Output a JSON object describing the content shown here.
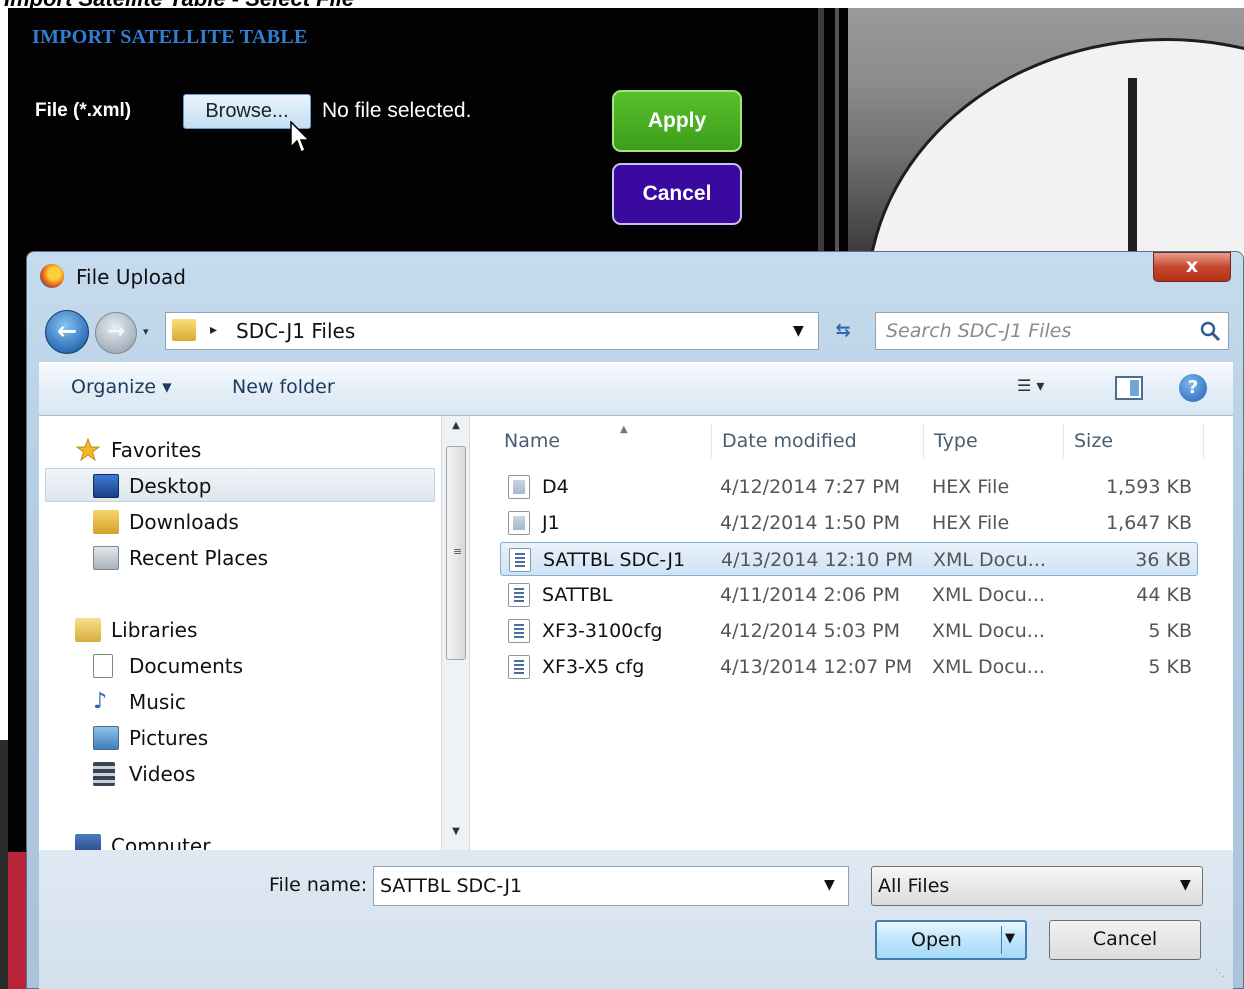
{
  "page": {
    "top_title": "Import Satellite Table - Select File",
    "heading": "IMPORT SATELLITE TABLE",
    "file_label": "File (*.xml)",
    "browse_label": "Browse...",
    "no_file_text": "No file selected.",
    "apply_label": "Apply",
    "cancel_label": "Cancel",
    "apply_color": "#4caf22",
    "cancel_color": "#3a0aa0"
  },
  "dialog": {
    "title": "File Upload",
    "close_label": "x",
    "address": {
      "arrow": "▸",
      "folder": "SDC-J1 Files"
    },
    "search_placeholder": "Search SDC-J1 Files",
    "toolbar": {
      "organize": "Organize ▾",
      "new_folder": "New folder"
    },
    "nav": {
      "favorites": "Favorites",
      "desktop": "Desktop",
      "downloads": "Downloads",
      "recent_places": "Recent Places",
      "libraries": "Libraries",
      "documents": "Documents",
      "music": "Music",
      "pictures": "Pictures",
      "videos": "Videos",
      "computer": "Computer"
    },
    "columns": {
      "name": "Name",
      "date": "Date modified",
      "type": "Type",
      "size": "Size"
    },
    "files": [
      {
        "name": "D4",
        "date": "4/12/2014 7:27 PM",
        "type": "HEX File",
        "size": "1,593 KB",
        "icon": "hex-file-icon"
      },
      {
        "name": "J1",
        "date": "4/12/2014 1:50 PM",
        "type": "HEX File",
        "size": "1,647 KB",
        "icon": "hex-file-icon"
      },
      {
        "name": "SATTBL SDC-J1",
        "date": "4/13/2014 12:10 PM",
        "type": "XML Docu...",
        "size": "36 KB",
        "icon": "xml-file-icon",
        "selected": true
      },
      {
        "name": "SATTBL",
        "date": "4/11/2014 2:06 PM",
        "type": "XML Docu...",
        "size": "44 KB",
        "icon": "xml-file-icon"
      },
      {
        "name": "XF3-3100cfg",
        "date": "4/12/2014 5:03 PM",
        "type": "XML Docu...",
        "size": "5 KB",
        "icon": "xml-file-icon"
      },
      {
        "name": "XF3-X5 cfg",
        "date": "4/13/2014 12:07 PM",
        "type": "XML Docu...",
        "size": "5 KB",
        "icon": "xml-file-icon"
      }
    ],
    "file_name_label": "File name:",
    "file_name_value": "SATTBL SDC-J1",
    "filter_value": "All Files",
    "open_label": "Open",
    "cancel_label": "Cancel"
  }
}
